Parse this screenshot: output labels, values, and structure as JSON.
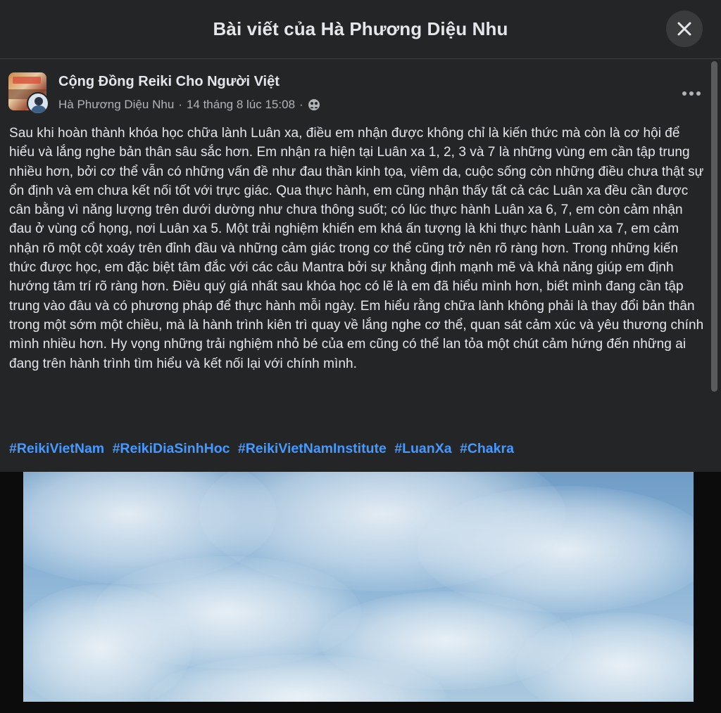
{
  "header": {
    "title": "Bài viết của Hà Phương Diệu Nhu"
  },
  "post": {
    "group_name": "Cộng Đồng Reiki Cho Người Việt",
    "author": "Hà Phương Diệu Nhu",
    "separator": "·",
    "timestamp": "14 tháng 8 lúc 15:08",
    "privacy_icon": "group-audience-icon",
    "body": "Sau khi hoàn thành khóa học chữa lành Luân xa, điều em nhận được không chỉ là kiến thức mà còn là cơ hội để hiểu và lắng nghe bản thân sâu sắc hơn. Em nhận ra hiện tại Luân xa 1, 2, 3 và 7 là những vùng em cần tập trung nhiều hơn, bởi cơ thể vẫn có những vấn đề như đau thần kinh tọa, viêm da, cuộc sống còn những điều chưa thật sự ổn định và em chưa kết nối tốt với trực giác. Qua thực hành, em cũng nhận thấy tất cả các Luân xa đều cần được cân bằng vì năng lượng trên dưới dường như chưa thông suốt; có lúc thực hành Luân xa 6, 7, em còn cảm nhận đau ở vùng cổ họng, nơi Luân xa 5. Một trải nghiệm khiến em khá ấn tượng là khi thực hành Luân xa 7, em cảm nhận rõ một cột xoáy trên đỉnh đầu và những cảm giác trong cơ thể cũng trở nên rõ ràng hơn. Trong những kiến thức được học, em đặc biệt tâm đắc với các câu Mantra bởi sự khẳng định mạnh mẽ và khả năng giúp em định hướng tâm trí rõ ràng hơn. Điều quý giá nhất sau khóa học có lẽ là em đã hiểu mình hơn, biết mình đang cần tập trung vào đâu và có phương pháp để thực hành mỗi ngày. Em hiểu rằng chữa lành không phải là thay đổi bản thân trong một sớm một chiều, mà là hành trình kiên trì quay về lắng nghe cơ thể, quan sát cảm xúc và yêu thương chính mình nhiều hơn. Hy vọng những trải nghiệm nhỏ bé của em cũng có thể lan tỏa một chút cảm hứng đến những ai đang trên hành trình tìm hiểu và kết nối lại với chính mình.",
    "hashtags": [
      "#ReikiVietNam",
      "#ReikiDiaSinhHoc",
      "#ReikiVietNamInstitute",
      "#LuanXa",
      "#Chakra"
    ]
  },
  "colors": {
    "background": "#242526",
    "text": "#e4e6eb",
    "secondary_text": "#b0b3b8",
    "hashtag": "#4599ff"
  }
}
